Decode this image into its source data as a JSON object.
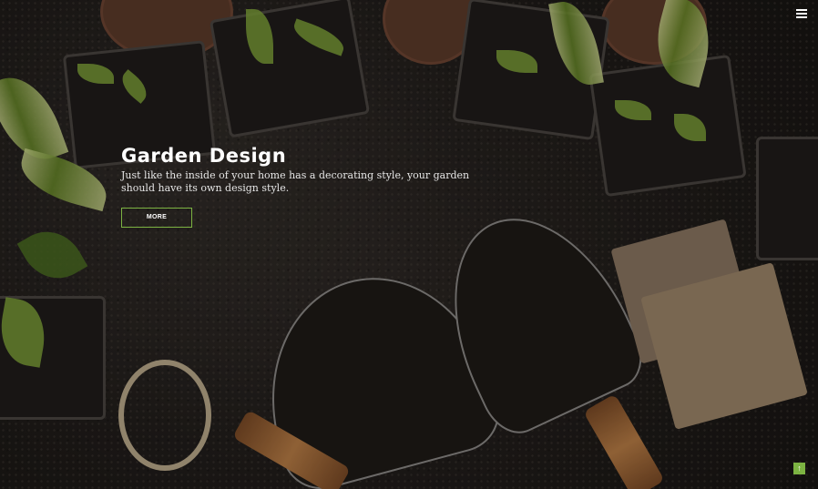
{
  "hero": {
    "title": "Garden Design",
    "description": "Just like the inside of your home has a decorating style, your garden should have its own design style.",
    "button_label": "MORE"
  },
  "icons": {
    "menu": "hamburger-icon",
    "back_to_top": "arrow-up-icon"
  },
  "colors": {
    "accent": "#7cb342",
    "text": "#ffffff"
  }
}
